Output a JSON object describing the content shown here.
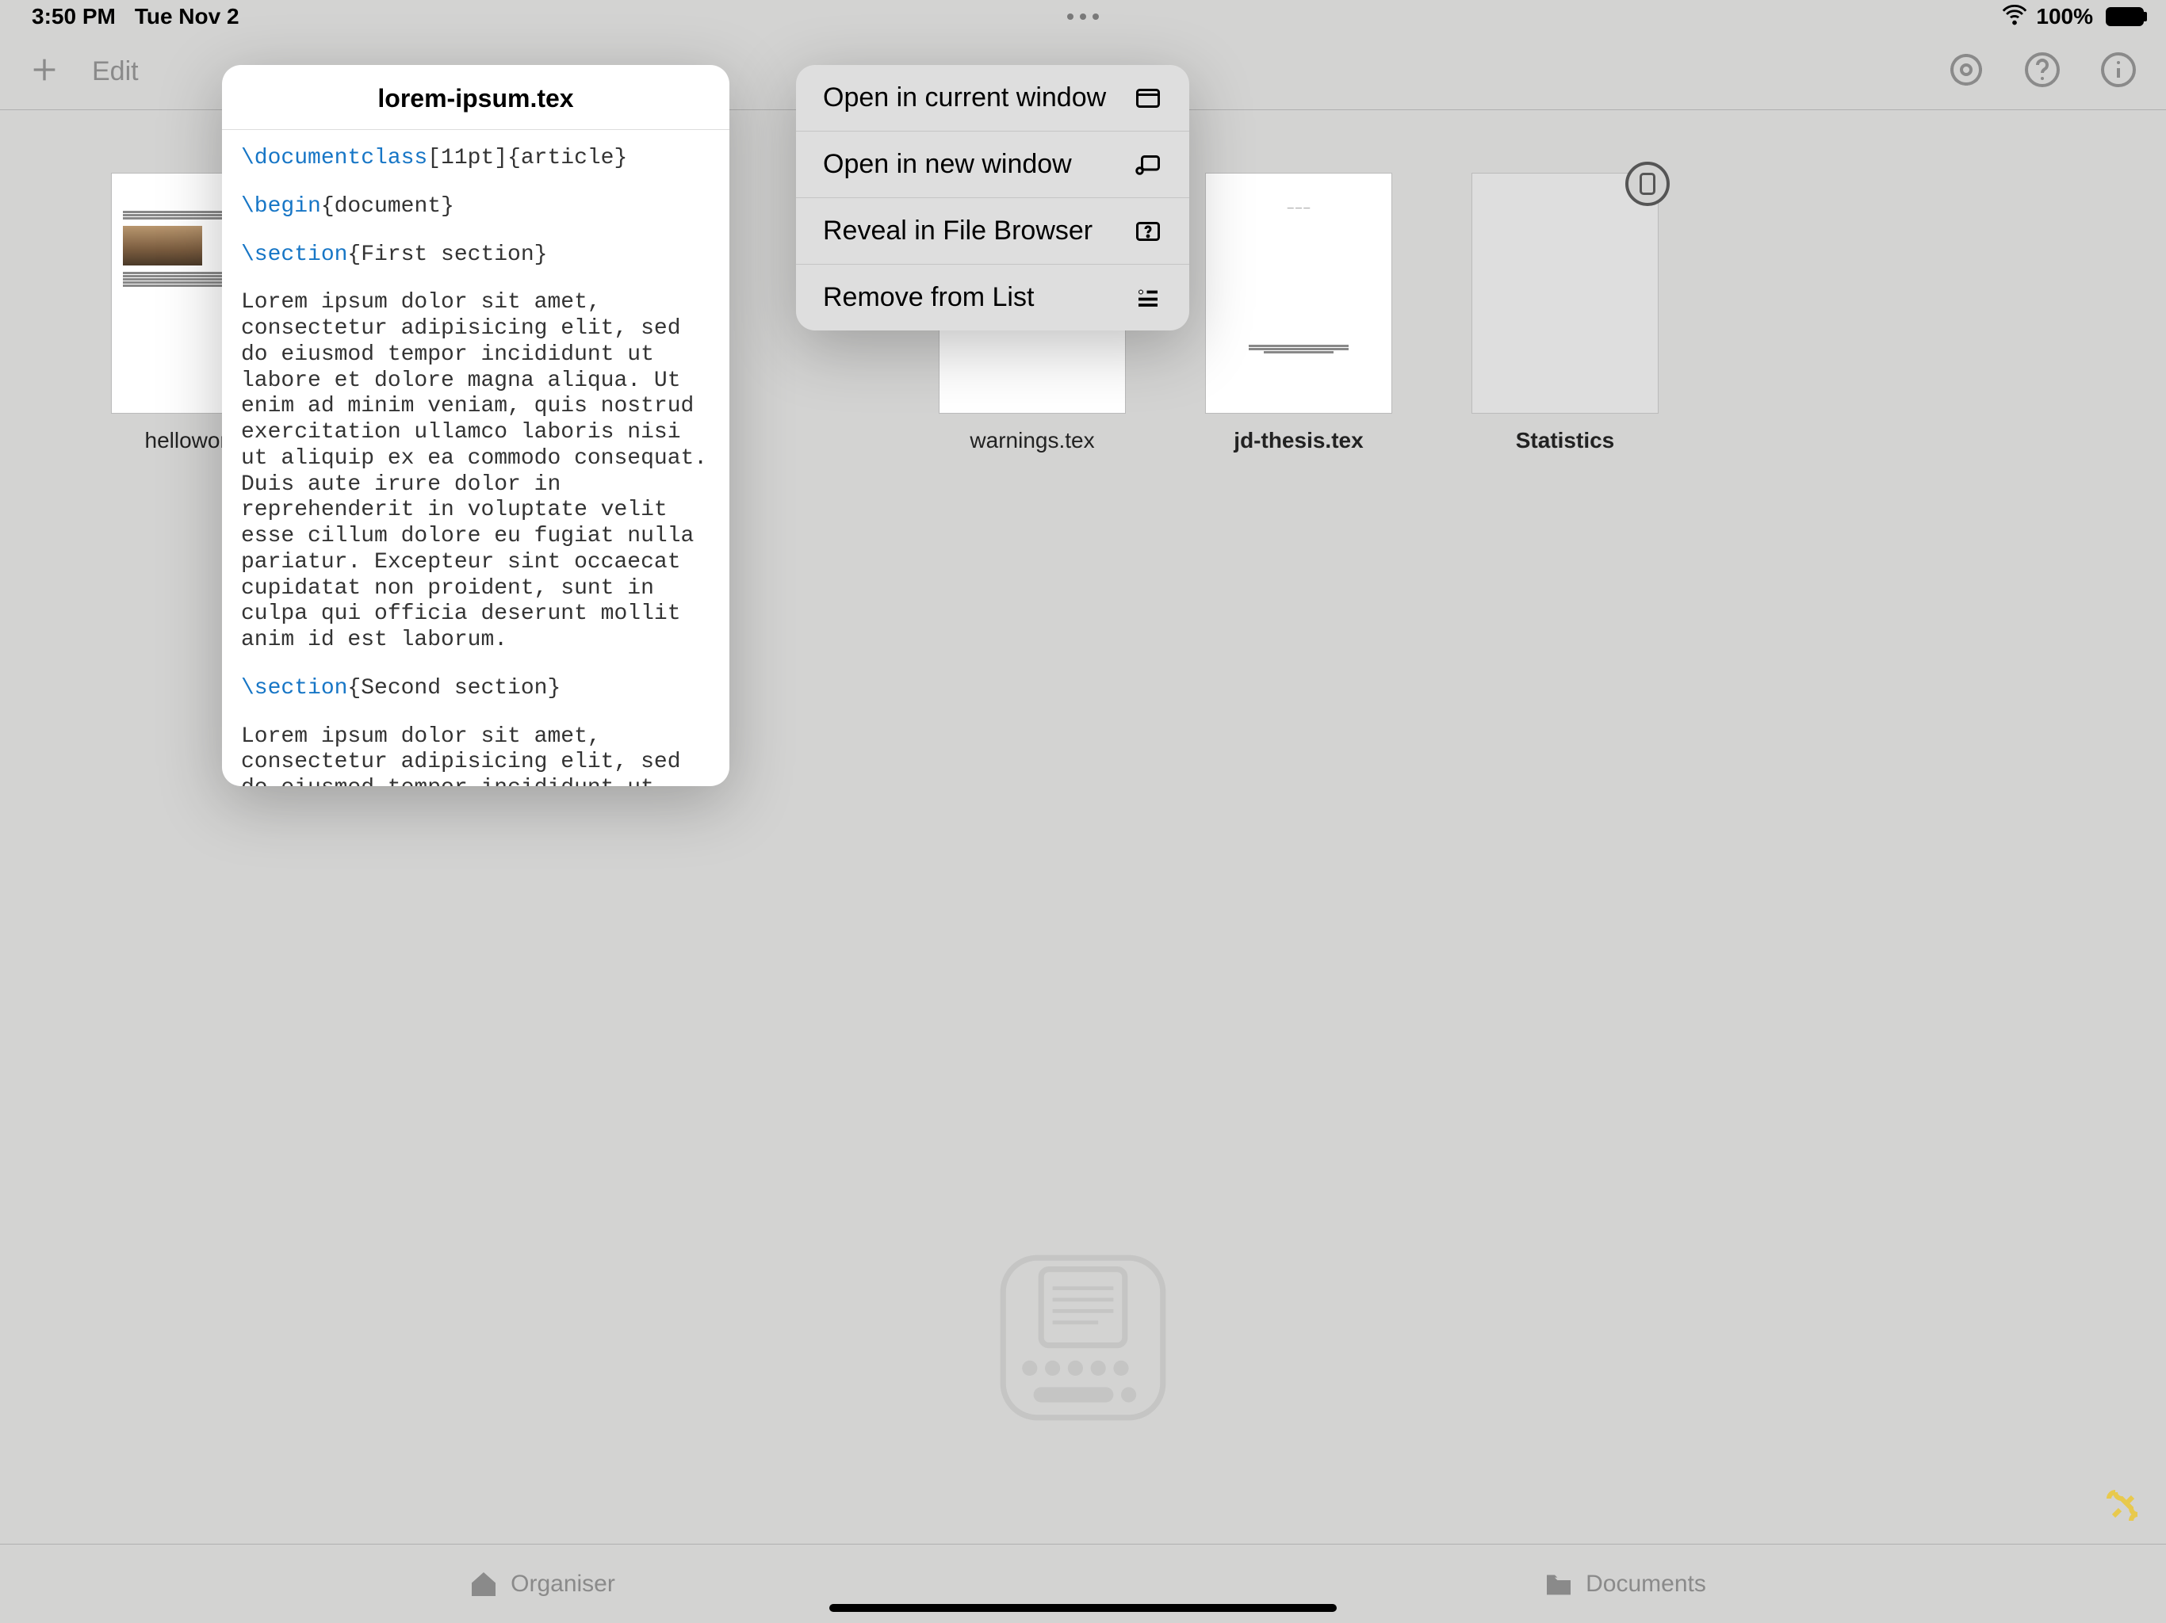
{
  "status": {
    "time": "3:50 PM",
    "date": "Tue Nov 2",
    "battery": "100%"
  },
  "toolbar": {
    "edit": "Edit"
  },
  "documents": [
    {
      "label": "helloworld-n"
    },
    {
      "label": "warnings.tex"
    },
    {
      "label": "jd-thesis.tex"
    },
    {
      "label": "Statistics"
    }
  ],
  "preview": {
    "title": "lorem-ipsum.tex",
    "cmd_documentclass": "\\documentclass",
    "args_documentclass": "[11pt]{article}",
    "cmd_begin": "\\begin",
    "args_begin": "{document}",
    "cmd_section1": "\\section",
    "args_section1": "{First section}",
    "body1": "Lorem ipsum dolor sit amet, consectetur adipisicing elit, sed do eiusmod tempor incididunt ut labore et dolore magna aliqua. Ut enim ad minim veniam, quis nostrud exercitation ullamco laboris nisi ut aliquip ex ea commodo consequat. Duis aute irure dolor in reprehenderit in voluptate velit esse cillum dolore eu fugiat nulla pariatur. Excepteur sint occaecat cupidatat non proident, sunt in culpa qui officia deserunt mollit anim id est laborum.",
    "cmd_section2": "\\section",
    "args_section2": "{Second section}",
    "body2": "Lorem ipsum dolor sit amet, consectetur adipisicing elit, sed do eiusmod tempor incididunt ut labore et"
  },
  "menu": {
    "item1": "Open in current window",
    "item2": "Open in new window",
    "item3": "Reveal in File Browser",
    "item4": "Remove from List"
  },
  "tabs": {
    "organiser": "Organiser",
    "documents": "Documents"
  }
}
